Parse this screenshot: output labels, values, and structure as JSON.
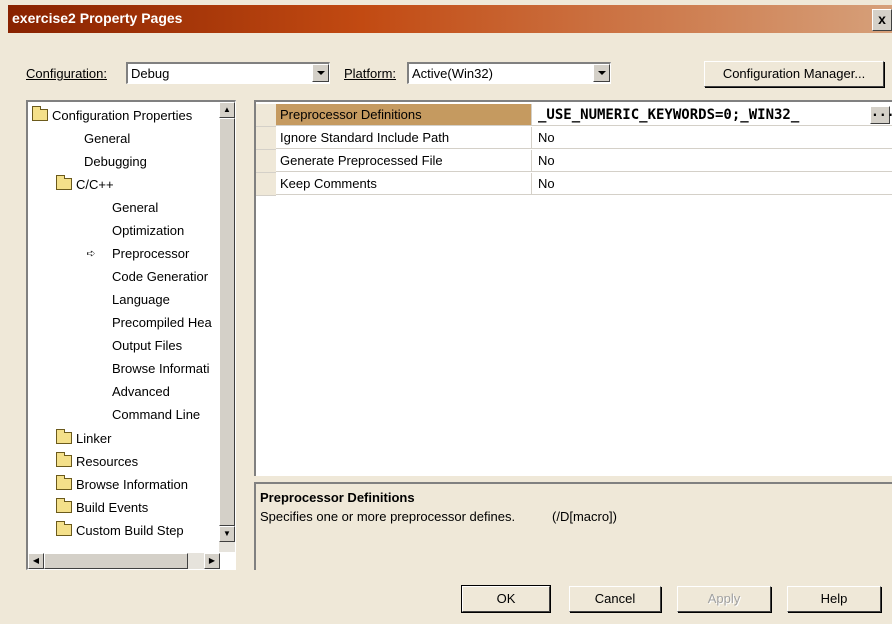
{
  "window": {
    "title": "exercise2 Property Pages",
    "close_label": "x"
  },
  "config_bar": {
    "configuration_label": "Configuration:",
    "configuration_value": "Debug",
    "platform_label": "Platform:",
    "platform_value": "Active(Win32)",
    "manager_button": "Configuration Manager..."
  },
  "tree": {
    "items": [
      {
        "label": "Configuration Properties",
        "icon": "open-folder-icon"
      },
      {
        "label": "General"
      },
      {
        "label": "Debugging"
      },
      {
        "label": "C/C++",
        "icon": "open-folder-icon"
      },
      {
        "label": "General"
      },
      {
        "label": "Optimization"
      },
      {
        "label": "Preprocessor",
        "selected_marker": "➪"
      },
      {
        "label": "Code Generatior"
      },
      {
        "label": "Language"
      },
      {
        "label": "Precompiled Hea"
      },
      {
        "label": "Output Files"
      },
      {
        "label": "Browse Informati"
      },
      {
        "label": "Advanced"
      },
      {
        "label": "Command Line"
      },
      {
        "label": "Linker",
        "icon": "folder-icon"
      },
      {
        "label": "Resources",
        "icon": "folder-icon"
      },
      {
        "label": "Browse Information",
        "icon": "folder-icon"
      },
      {
        "label": "Build Events",
        "icon": "folder-icon"
      },
      {
        "label": "Custom Build Step",
        "icon": "folder-icon"
      }
    ]
  },
  "properties": [
    {
      "name": "Preprocessor Definitions",
      "value": "_USE_NUMERIC_KEYWORDS=0;_WIN32_",
      "ellipsis": "..."
    },
    {
      "name": "Ignore Standard Include Path",
      "value": "No"
    },
    {
      "name": "Generate Preprocessed File",
      "value": "No"
    },
    {
      "name": "Keep Comments",
      "value": "No"
    }
  ],
  "description": {
    "title": "Preprocessor Definitions",
    "text": "Specifies one or more preprocessor defines.",
    "switch": "(/D[macro])"
  },
  "buttons": {
    "ok": "OK",
    "cancel": "Cancel",
    "apply": "Apply",
    "help": "Help"
  },
  "colors": {
    "title_gradient_start": "#882200",
    "selected_row": "#c59a60",
    "dialog_background": "#efe8d8"
  }
}
